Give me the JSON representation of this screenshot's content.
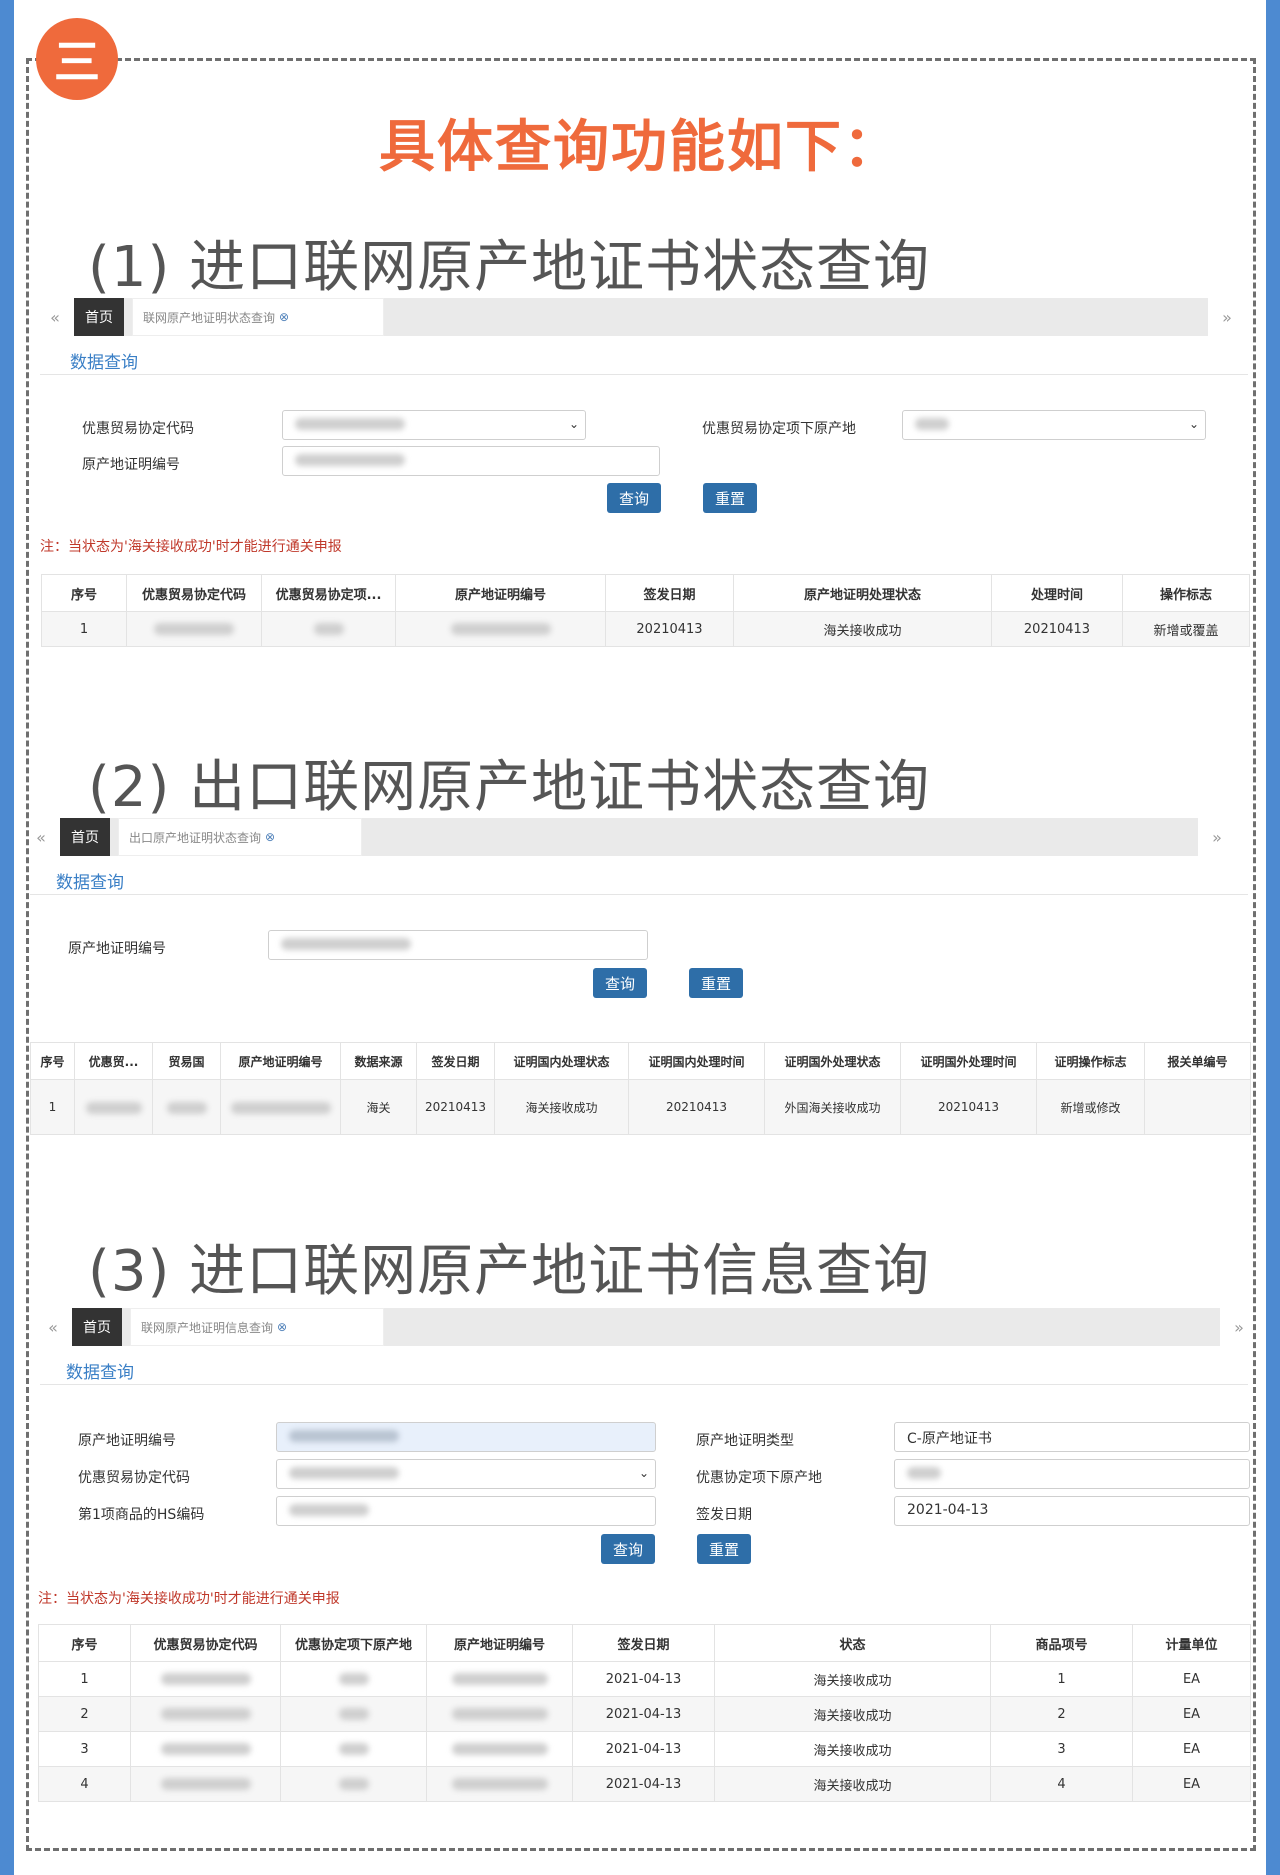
{
  "badge": "三",
  "main_heading": "具体查询功能如下：",
  "tab_home": "首页",
  "data_query": "数据查询",
  "btn_query": "查询",
  "btn_reset": "重置",
  "section1": {
    "title": "(1) 进口联网原产地证书状态查询",
    "tab_label": "联网原产地证明状态查询",
    "labels": {
      "agreement_code": "优惠贸易协定代码",
      "origin_under_agreement": "优惠贸易协定项下原产地",
      "cert_no": "原产地证明编号"
    },
    "note": "注：当状态为'海关接收成功'时才能进行通关申报",
    "columns": [
      "序号",
      "优惠贸易协定代码",
      "优惠贸易协定项...",
      "原产地证明编号",
      "签发日期",
      "原产地证明处理状态",
      "处理时间",
      "操作标志"
    ],
    "rows": [
      {
        "no": "1",
        "sign_date": "20210413",
        "status": "海关接收成功",
        "time": "20210413",
        "op": "新增或覆盖"
      }
    ]
  },
  "section2": {
    "title": "(2) 出口联网原产地证书状态查询",
    "tab_label": "出口原产地证明状态查询",
    "labels": {
      "cert_no": "原产地证明编号"
    },
    "columns": [
      "序号",
      "优惠贸...",
      "贸易国",
      "原产地证明编号",
      "数据来源",
      "签发日期",
      "证明国内处理状态",
      "证明国内处理时间",
      "证明国外处理状态",
      "证明国外处理时间",
      "证明操作标志",
      "报关单编号"
    ],
    "rows": [
      {
        "no": "1",
        "source": "海关",
        "sign_date": "20210413",
        "dom_status": "海关接收成功",
        "dom_time": "20210413",
        "for_status": "外国海关接收成功",
        "for_time": "20210413",
        "op": "新增或修改"
      }
    ]
  },
  "section3": {
    "title": "(3) 进口联网原产地证书信息查询",
    "tab_label": "联网原产地证明信息查询",
    "labels": {
      "cert_no": "原产地证明编号",
      "agreement_code": "优惠贸易协定代码",
      "hs_code": "第1项商品的HS编码",
      "cert_type": "原产地证明类型",
      "origin_under": "优惠协定项下原产地",
      "sign_date": "签发日期"
    },
    "values": {
      "cert_type": "C-原产地证书",
      "sign_date": "2021-04-13"
    },
    "note": "注：当状态为'海关接收成功'时才能进行通关申报",
    "columns": [
      "序号",
      "优惠贸易协定代码",
      "优惠协定项下原产地",
      "原产地证明编号",
      "签发日期",
      "状态",
      "商品项号",
      "计量单位"
    ],
    "rows": [
      {
        "no": "1",
        "date": "2021-04-13",
        "status": "海关接收成功",
        "item": "1",
        "unit": "EA"
      },
      {
        "no": "2",
        "date": "2021-04-13",
        "status": "海关接收成功",
        "item": "2",
        "unit": "EA"
      },
      {
        "no": "3",
        "date": "2021-04-13",
        "status": "海关接收成功",
        "item": "3",
        "unit": "EA"
      },
      {
        "no": "4",
        "date": "2021-04-13",
        "status": "海关接收成功",
        "item": "4",
        "unit": "EA"
      }
    ]
  }
}
